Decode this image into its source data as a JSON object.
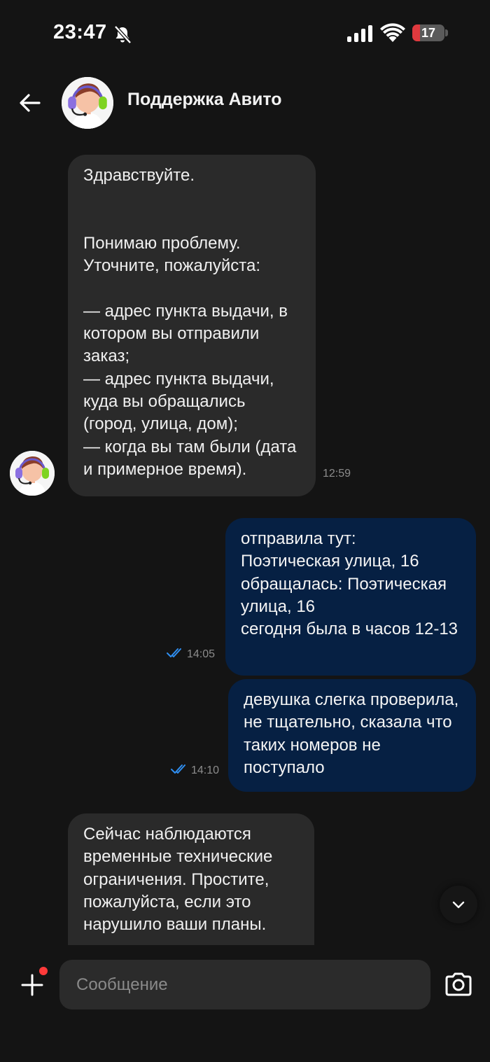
{
  "status_bar": {
    "time": "23:47",
    "battery": "17",
    "icons": [
      "bell-slash-icon",
      "signal-icon",
      "wifi-icon",
      "battery-icon"
    ],
    "battery_color": "#e0393e"
  },
  "header": {
    "title": "Поддержка Авито",
    "back_icon": "arrow-left-icon",
    "avatar": "support-agent-avatar"
  },
  "messages": [
    {
      "direction": "incoming",
      "text": "Здравствуйте.\n\n\nПонимаю проблему.\nУточните, пожалуйста:\n\n— адрес пункта выдачи, в котором вы отправили заказ;\n— адрес пункта выдачи, куда вы обращались (город, улица, дом);\n— когда вы там были (дата и примерное время).",
      "time": "12:59"
    },
    {
      "direction": "outgoing",
      "text": "отправила тут:\nПоэтическая улица, 16\nобращалась: Поэтическая улица, 16\nсегодня была в часов 12-13",
      "time": "14:05",
      "status": "read"
    },
    {
      "direction": "outgoing",
      "text": "девушка слегка проверила, не тщательно, сказала что таких номеров не поступало",
      "time": "14:10",
      "status": "read"
    },
    {
      "direction": "incoming",
      "text": "Сейчас наблюдаются временные технические ограничения. Простите, пожалуйста, если это нарушило ваши планы."
    }
  ],
  "composer": {
    "placeholder": "Сообщение",
    "attach_icon": "plus-icon",
    "camera_icon": "camera-icon"
  },
  "colors": {
    "background": "#141414",
    "incoming_bubble": "#2a2a2a",
    "outgoing_bubble": "#062043",
    "read_ticks": "#2f8ef0",
    "notification_dot": "#ff3a3a"
  }
}
